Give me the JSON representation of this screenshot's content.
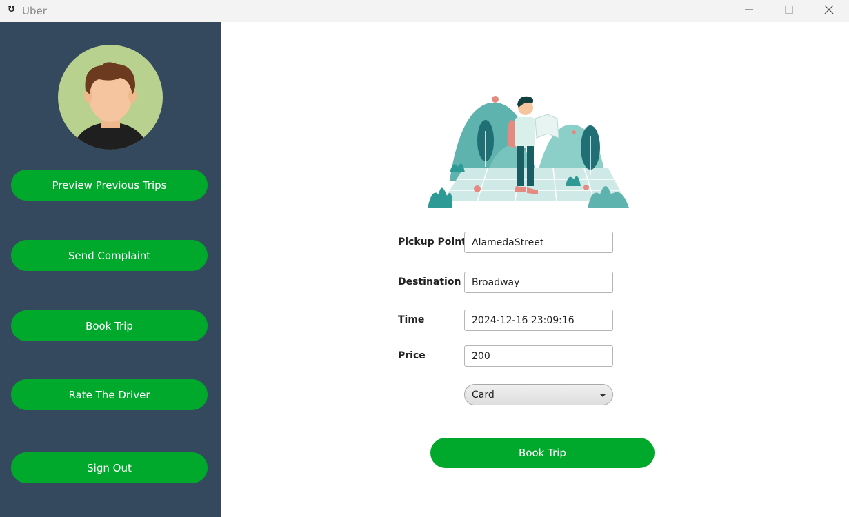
{
  "window": {
    "title": "Uber",
    "app_icon_glyph": "Ʊ",
    "controls": [
      "minimize-icon",
      "maximize-icon",
      "close-icon"
    ]
  },
  "sidebar": {
    "avatar_icon": "user-avatar",
    "buttons": [
      {
        "label": "Preview Previous Trips"
      },
      {
        "label": "Send Complaint"
      },
      {
        "label": "Book Trip"
      },
      {
        "label": "Rate The Driver"
      },
      {
        "label": "Sign Out"
      }
    ]
  },
  "form": {
    "pickup": {
      "label": "Pickup Point",
      "value": "AlamedaStreet"
    },
    "destination": {
      "label": "Destination",
      "value": "Broadway"
    },
    "time": {
      "label": "Time",
      "value": "2024-12-16 23:09:16"
    },
    "price": {
      "label": "Price",
      "value": "200"
    },
    "payment": {
      "selected": "Card"
    },
    "submit_label": "Book Trip"
  },
  "colors": {
    "sidebar_bg": "#34495e",
    "accent_green": "#00a92c",
    "avatar_bg": "#b8d18f",
    "illustration_teal": "#4aa9a4"
  }
}
